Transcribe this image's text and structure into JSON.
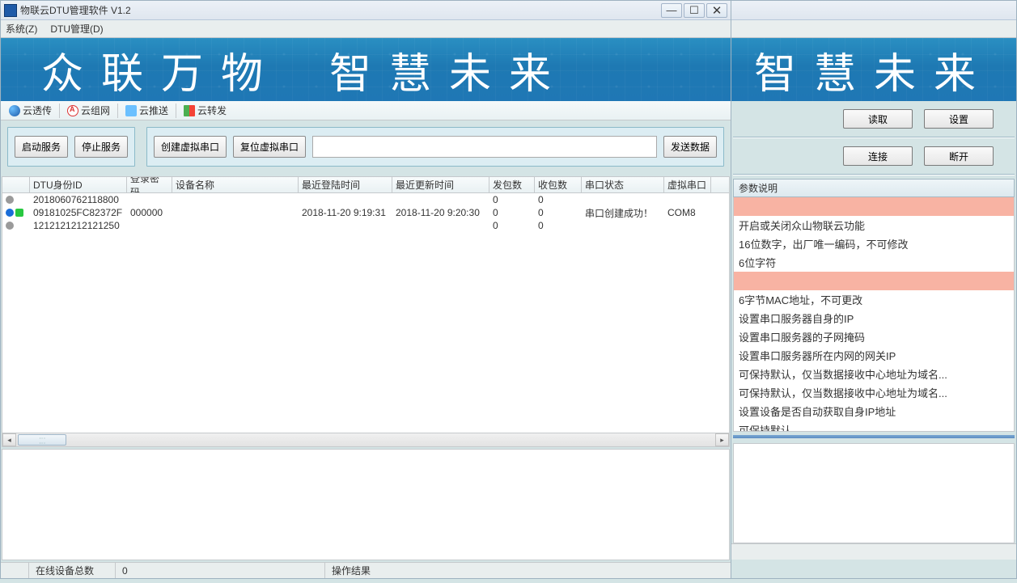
{
  "window": {
    "title": "物联云DTU管理软件 V1.2"
  },
  "menu": {
    "system": "系统(Z)",
    "dtu": "DTU管理(D)"
  },
  "banner": {
    "left": "众联万物",
    "right": "智慧未来",
    "right2": "智慧未来"
  },
  "tabs": {
    "passthrough": "云透传",
    "network": "云组网",
    "push": "云推送",
    "forward": "云转发"
  },
  "actions": {
    "start_service": "启动服务",
    "stop_service": "停止服务",
    "create_vport": "创建虚拟串口",
    "reset_vport": "复位虚拟串口",
    "send_data": "发送数据"
  },
  "columns": {
    "id": "DTU身份ID",
    "pwd": "登录密码",
    "name": "设备名称",
    "last_login": "最近登陆时间",
    "last_update": "最近更新时间",
    "send": "发包数",
    "recv": "收包数",
    "serial": "串口状态",
    "vcom": "虚拟串口"
  },
  "rows": [
    {
      "status": "gray",
      "id": "2018060762118800",
      "pwd": "",
      "name": "",
      "last_login": "",
      "last_update": "",
      "send": "0",
      "recv": "0",
      "serial": "",
      "vcom": ""
    },
    {
      "status": "active",
      "id": "09181025FC82372F",
      "pwd": "000000",
      "name": "",
      "last_login": "2018-11-20 9:19:31",
      "last_update": "2018-11-20 9:20:30",
      "send": "0",
      "recv": "0",
      "serial": "串口创建成功！",
      "vcom": "COM8"
    },
    {
      "status": "gray",
      "id": "1212121212121250",
      "pwd": "",
      "name": "",
      "last_login": "",
      "last_update": "",
      "send": "0",
      "recv": "0",
      "serial": "",
      "vcom": ""
    }
  ],
  "status": {
    "online_label": "在线设备总数",
    "online_value": "0",
    "op_label": "操作结果"
  },
  "right": {
    "read": "读取",
    "set": "设置",
    "connect": "连接",
    "disconnect": "断开",
    "param_head": "参数说明",
    "params": [
      {
        "text": "",
        "pink": true
      },
      {
        "text": "开启或关闭众山物联云功能"
      },
      {
        "text": "16位数字，出厂唯一编码，不可修改"
      },
      {
        "text": "6位字符"
      },
      {
        "text": "",
        "pink": true
      },
      {
        "text": "6字节MAC地址，不可更改"
      },
      {
        "text": "设置串口服务器自身的IP"
      },
      {
        "text": "设置串口服务器的子网掩码"
      },
      {
        "text": "设置串口服务器所在内网的网关IP"
      },
      {
        "text": "可保持默认，仅当数据接收中心地址为域名..."
      },
      {
        "text": "可保持默认，仅当数据接收中心地址为域名..."
      },
      {
        "text": "设置设备是否自动获取自身IP地址"
      },
      {
        "text": "可保持默认"
      }
    ]
  }
}
